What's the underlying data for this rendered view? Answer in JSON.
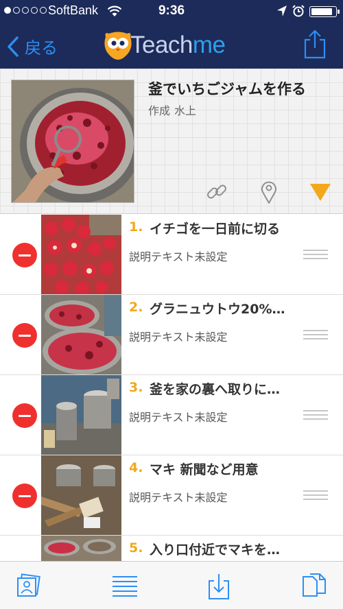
{
  "status_bar": {
    "carrier": "SoftBank",
    "time": "9:36",
    "signal_bars": 1,
    "signal_total": 5,
    "battery_level": 0.92
  },
  "nav": {
    "back_label": "戻る",
    "logo_text_left": "Teach",
    "logo_text_right": "me"
  },
  "header": {
    "title": "釜でいちごジャムを作る",
    "author_prefix": "作成",
    "author_name": "水上"
  },
  "steps": [
    {
      "number": "1.",
      "title": "イチゴを一日前に切る",
      "description": "説明テキスト未設定"
    },
    {
      "number": "2.",
      "title": "グラニュウトウ20%…",
      "description": "説明テキスト未設定"
    },
    {
      "number": "3.",
      "title": "釜を家の裏へ取りに…",
      "description": "説明テキスト未設定"
    },
    {
      "number": "4.",
      "title": "マキ 新聞など用意",
      "description": "説明テキスト未設定"
    },
    {
      "number": "5.",
      "title": "入り口付近でマキを…",
      "description": ""
    }
  ],
  "colors": {
    "nav_background": "#1d2b5a",
    "accent_blue": "#2b8ff5",
    "step_number": "#f2a81a",
    "delete_red": "#f0302e"
  },
  "icons": [
    "back-chevron-icon",
    "teachme-owl-logo-icon",
    "share-icon",
    "link-icon",
    "location-pin-icon",
    "expand-triangle-icon",
    "delete-icon",
    "reorder-grip-icon",
    "photos-icon",
    "list-icon",
    "download-icon",
    "copy-icon"
  ]
}
